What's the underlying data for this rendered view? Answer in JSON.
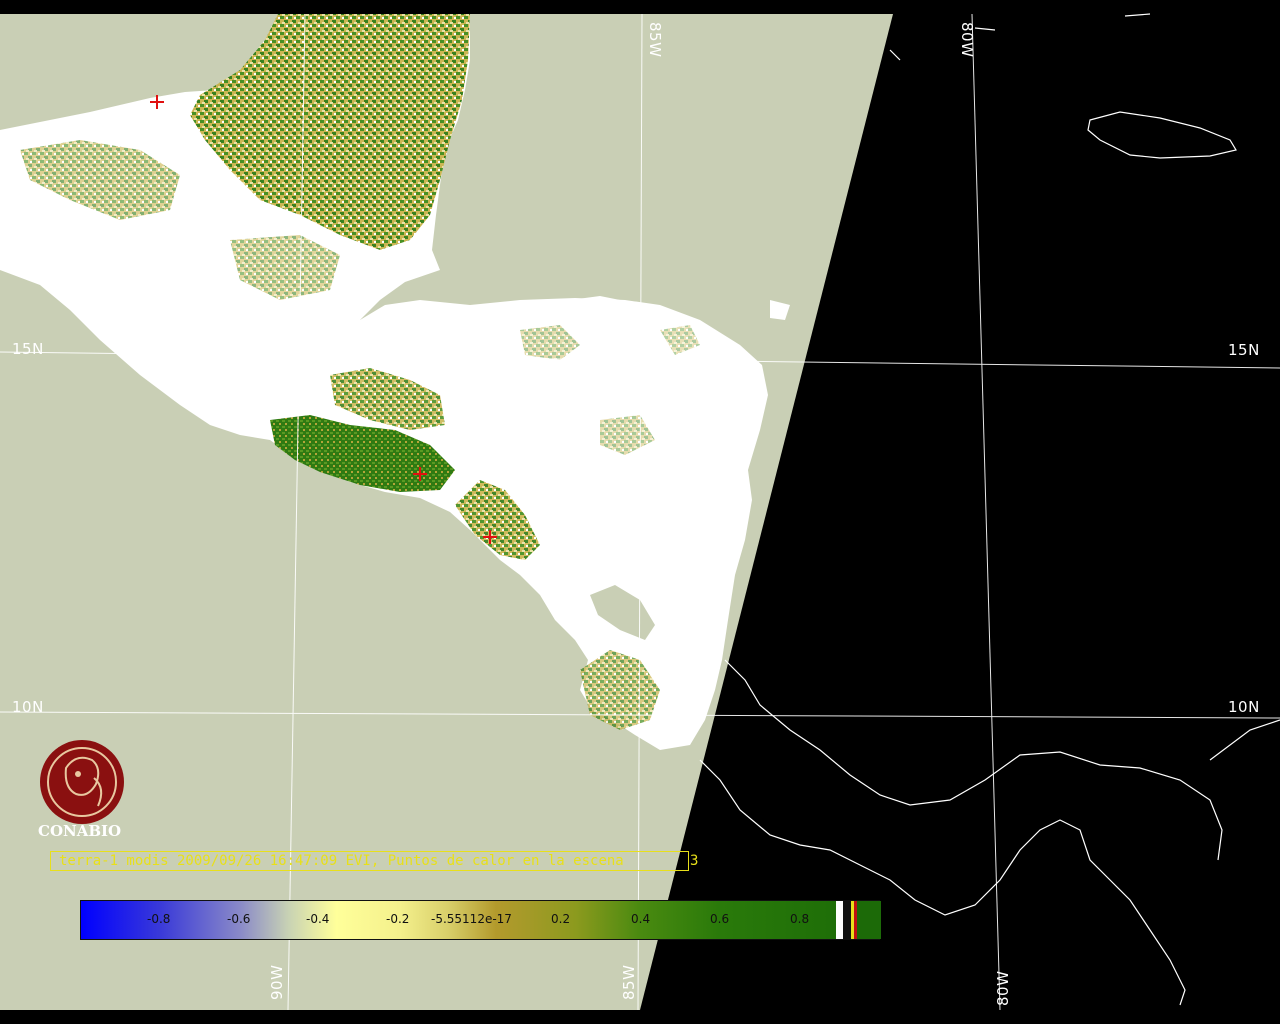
{
  "map": {
    "grid": {
      "lat_labels": [
        "15N",
        "15N",
        "10N",
        "10N"
      ],
      "lon_labels": [
        "85W",
        "80W",
        "90W",
        "85W",
        "80W"
      ]
    }
  },
  "logo": {
    "text": "CONABIO"
  },
  "caption": {
    "text": "terra-1 modis 2009/09/26 16:47:09 EVI, Puntos de calor en la escena",
    "count": "3"
  },
  "colorbar": {
    "ticks": [
      "-0.8",
      "-0.6",
      "-0.4",
      "-0.2",
      "-5.55112e-17",
      "0.2",
      "0.4",
      "0.6",
      "0.8"
    ]
  },
  "colors": {
    "ocean": "#c9cfb5",
    "land_cloud": "#ffffff",
    "vegetation": "#2f7a12",
    "night_side": "#000000",
    "caption": "#e8e01a",
    "hotspot": "#e01010"
  }
}
